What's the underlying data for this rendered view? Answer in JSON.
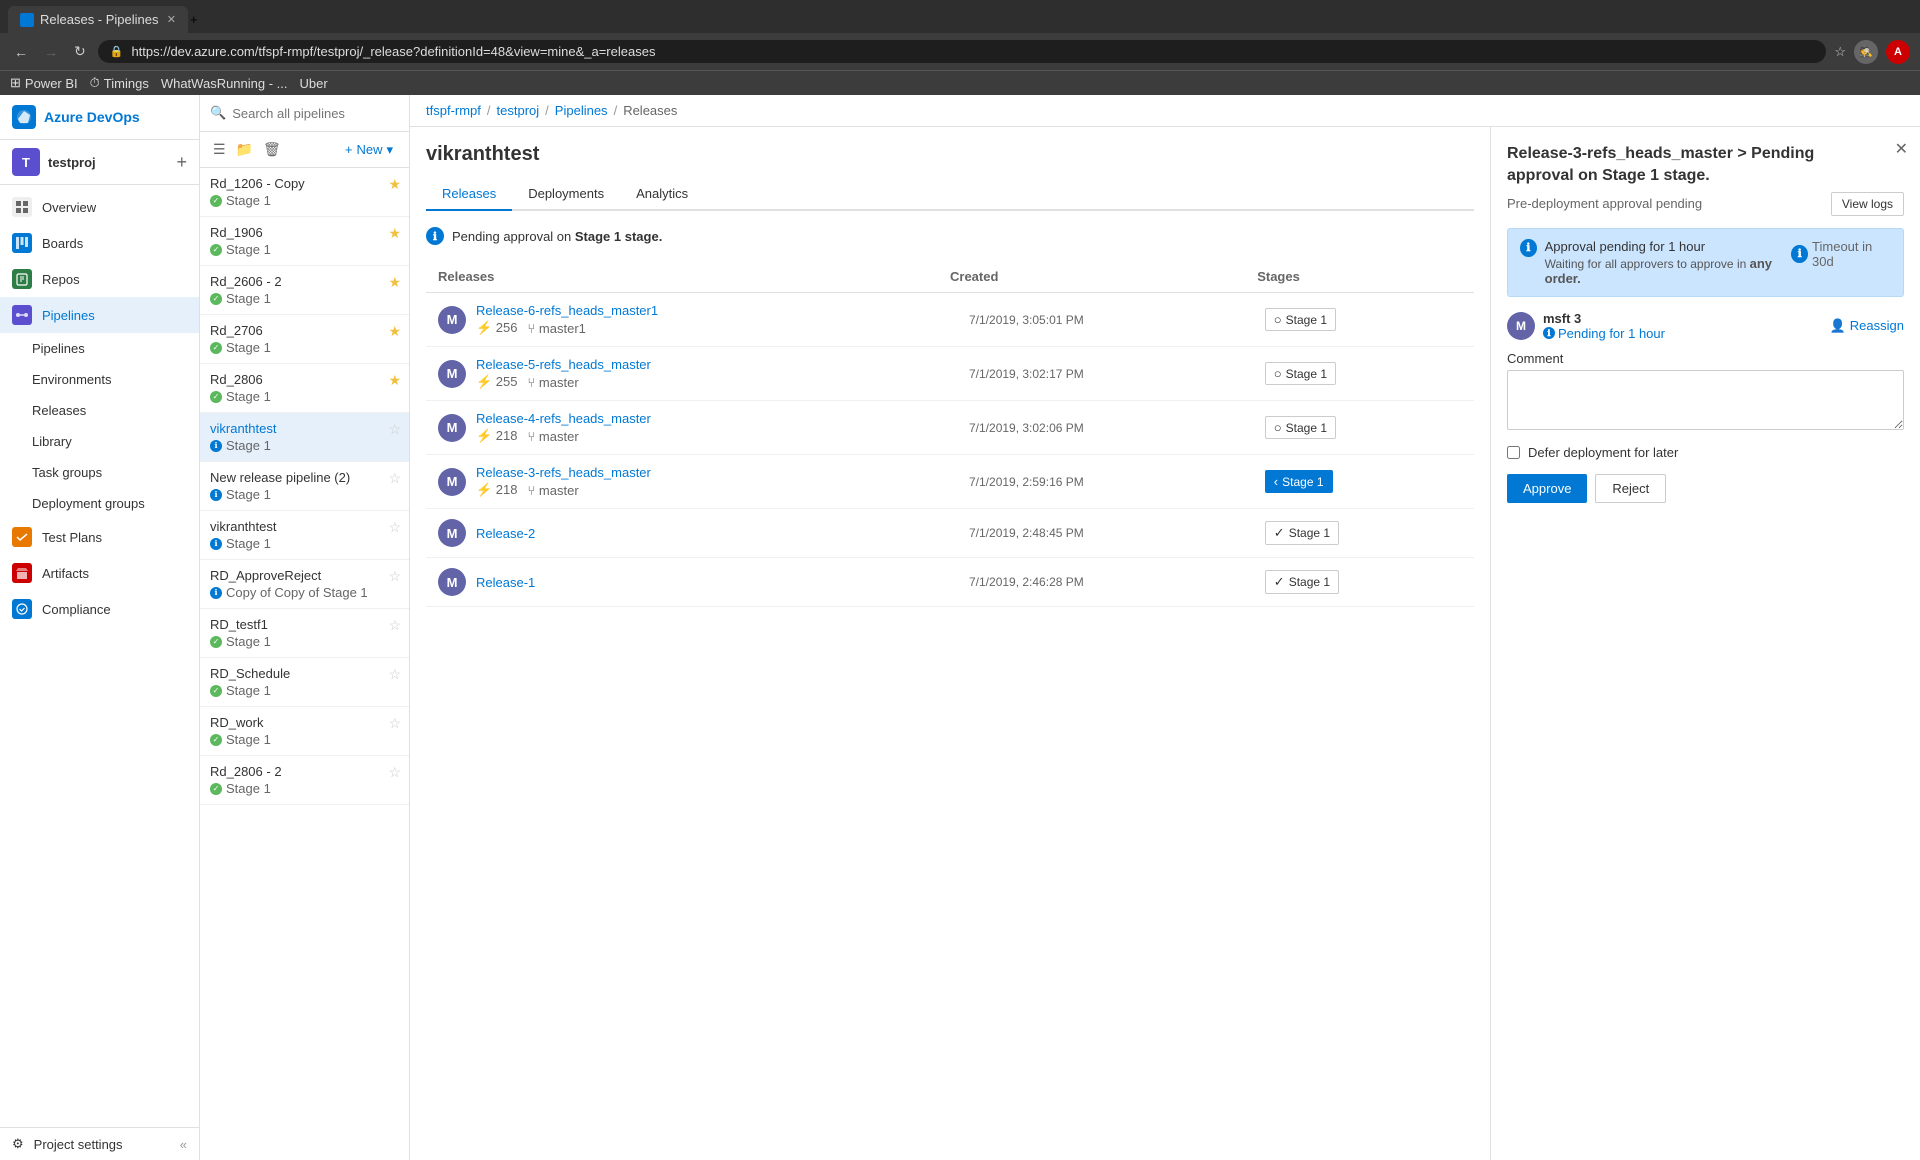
{
  "browser": {
    "tab_title": "Releases - Pipelines",
    "url": "https://dev.azure.com/tfspf-rmpf/testproj/_release?definitionId=48&view=mine&_a=releases",
    "bookmarks": [
      {
        "label": "Power BI"
      },
      {
        "label": "Timings"
      },
      {
        "label": "WhatWasRunning - ..."
      },
      {
        "label": "Uber"
      }
    ]
  },
  "sidebar": {
    "logo": "Azure DevOps",
    "project": {
      "avatar": "T",
      "name": "testproj"
    },
    "items": [
      {
        "id": "overview",
        "label": "Overview",
        "icon": "📋"
      },
      {
        "id": "boards",
        "label": "Boards",
        "icon": "⊞"
      },
      {
        "id": "repos",
        "label": "Repos",
        "icon": "🗂"
      },
      {
        "id": "pipelines",
        "label": "Pipelines",
        "icon": "⚡"
      },
      {
        "id": "pipelines-sub",
        "label": "Pipelines",
        "icon": ""
      },
      {
        "id": "environments",
        "label": "Environments",
        "icon": ""
      },
      {
        "id": "releases",
        "label": "Releases",
        "icon": "🚀"
      },
      {
        "id": "library",
        "label": "Library",
        "icon": ""
      },
      {
        "id": "task-groups",
        "label": "Task groups",
        "icon": ""
      },
      {
        "id": "deployment-groups",
        "label": "Deployment groups",
        "icon": ""
      },
      {
        "id": "test-plans",
        "label": "Test Plans",
        "icon": "✔"
      },
      {
        "id": "artifacts",
        "label": "Artifacts",
        "icon": "📦"
      },
      {
        "id": "compliance",
        "label": "Compliance",
        "icon": ""
      }
    ],
    "footer": {
      "label": "Project settings"
    }
  },
  "pipeline_list": {
    "search_placeholder": "Search all pipelines",
    "new_button": "New",
    "entries": [
      {
        "name": "Rd_1206 - Copy",
        "stage": "Stage 1",
        "stage_status": "success",
        "starred": true
      },
      {
        "name": "Rd_1906",
        "stage": "Stage 1",
        "stage_status": "success",
        "starred": true
      },
      {
        "name": "Rd_2606 - 2",
        "stage": "Stage 1",
        "stage_status": "success",
        "starred": true
      },
      {
        "name": "Rd_2706",
        "stage": "Stage 1",
        "stage_status": "success",
        "starred": true
      },
      {
        "name": "Rd_2806",
        "stage": "Stage 1",
        "stage_status": "success",
        "starred": true
      },
      {
        "name": "vikranthtest",
        "stage": "Stage 1",
        "stage_status": "info",
        "starred": false,
        "active": true
      },
      {
        "name": "New release pipeline (2)",
        "stage": "Stage 1",
        "stage_status": "info",
        "starred": false
      },
      {
        "name": "vikranthtest",
        "stage": "Stage 1",
        "stage_status": "info",
        "starred": false
      },
      {
        "name": "RD_ApproveReject",
        "stage": "Copy of Copy of Stage 1",
        "stage_status": "info",
        "starred": false
      },
      {
        "name": "RD_testf1",
        "stage": "Stage 1",
        "stage_status": "success",
        "starred": false
      },
      {
        "name": "RD_Schedule",
        "stage": "Stage 1",
        "stage_status": "success",
        "starred": false
      },
      {
        "name": "RD_work",
        "stage": "Stage 1",
        "stage_status": "success",
        "starred": false
      },
      {
        "name": "Rd_2806 - 2",
        "stage": "Stage 1",
        "stage_status": "success",
        "starred": false
      }
    ]
  },
  "breadcrumb": {
    "items": [
      "tfspf-rmpf",
      "testproj",
      "Pipelines",
      "Releases"
    ]
  },
  "main": {
    "title": "vikranthtest",
    "tabs": [
      {
        "id": "releases",
        "label": "Releases",
        "active": true
      },
      {
        "id": "deployments",
        "label": "Deployments",
        "active": false
      },
      {
        "id": "analytics",
        "label": "Analytics",
        "active": false
      }
    ],
    "pending_banner": "Pending approval on Stage 1 stage.",
    "table": {
      "headers": [
        "Releases",
        "Created",
        "Stages"
      ],
      "rows": [
        {
          "avatar": "M",
          "name": "Release-6-refs_heads_master1",
          "meta_count": "256",
          "meta_branch": "master1",
          "created": "7/1/2019, 3:05:01 PM",
          "stage_label": "Stage 1",
          "stage_type": "empty"
        },
        {
          "avatar": "M",
          "name": "Release-5-refs_heads_master",
          "meta_count": "255",
          "meta_branch": "master",
          "created": "7/1/2019, 3:02:17 PM",
          "stage_label": "Stage 1",
          "stage_type": "empty"
        },
        {
          "avatar": "M",
          "name": "Release-4-refs_heads_master",
          "meta_count": "218",
          "meta_branch": "master",
          "created": "7/1/2019, 3:02:06 PM",
          "stage_label": "Stage 1",
          "stage_type": "empty"
        },
        {
          "avatar": "M",
          "name": "Release-3-refs_heads_master",
          "meta_count": "218",
          "meta_branch": "master",
          "created": "7/1/2019, 2:59:16 PM",
          "stage_label": "Stage 1",
          "stage_type": "pending"
        },
        {
          "avatar": "M",
          "name": "Release-2",
          "meta_count": "",
          "meta_branch": "",
          "created": "7/1/2019, 2:48:45 PM",
          "stage_label": "Stage 1",
          "stage_type": "success"
        },
        {
          "avatar": "M",
          "name": "Release-1",
          "meta_count": "",
          "meta_branch": "",
          "created": "7/1/2019, 2:46:28 PM",
          "stage_label": "Stage 1",
          "stage_type": "success"
        }
      ]
    }
  },
  "right_panel": {
    "title": "Release-3-refs_heads_master > Pending approval on Stage 1 stage.",
    "subtitle": "Pre-deployment approval pending",
    "view_logs_btn": "View logs",
    "approval_card": {
      "text": "Approval pending for 1 hour",
      "sub": "Waiting for all approvers to approve in any order.",
      "timeout": "Timeout in 30d"
    },
    "approver": {
      "avatar": "M",
      "name": "msft 3",
      "status": "Pending for 1 hour"
    },
    "reassign_btn": "Reassign",
    "comment_label": "Comment",
    "comment_placeholder": "",
    "defer_label": "Defer deployment for later",
    "approve_btn": "Approve",
    "reject_btn": "Reject"
  }
}
